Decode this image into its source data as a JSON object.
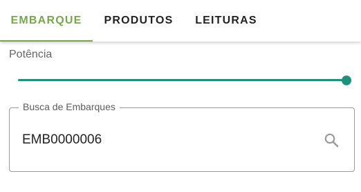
{
  "tabs": [
    {
      "label": "EMBARQUE",
      "active": true
    },
    {
      "label": "PRODUTOS",
      "active": false
    },
    {
      "label": "LEITURAS",
      "active": false
    }
  ],
  "power": {
    "label": "Potência",
    "value_fraction": 1.0
  },
  "search": {
    "label": "Busca de Embarques",
    "value": "EMB0000006",
    "icon": "search-icon"
  },
  "colors": {
    "active_tab": "#74a84a",
    "slider_accent": "#1b927c"
  }
}
